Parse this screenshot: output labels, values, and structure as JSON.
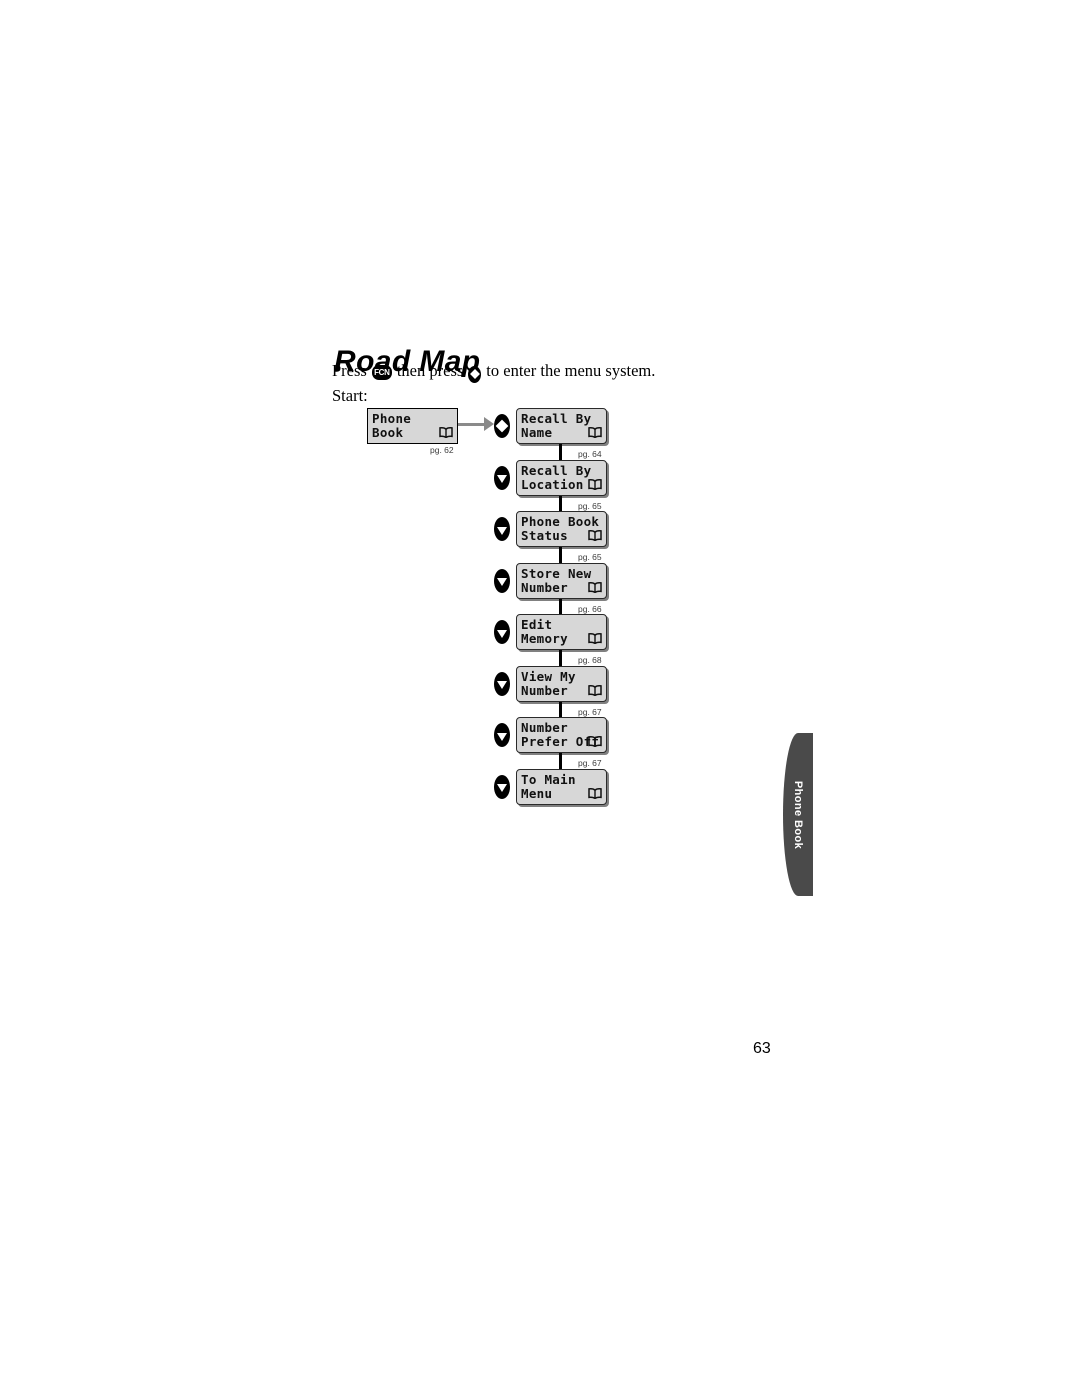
{
  "document": {
    "title": "Road Map",
    "page_number": "63",
    "side_tab_label": "Phone Book"
  },
  "intro": {
    "press_text": "Press",
    "fcn_key_label": "FCN",
    "then_press_text": "then press",
    "nav_key_icon": "nav-diamond-icon",
    "tail_text": "to enter the menu system.",
    "start_label": "Start:"
  },
  "start_node": {
    "line1": "Phone",
    "line2": "Book",
    "icon": "book-icon",
    "page_ref": "pg. 62"
  },
  "arrow": {
    "icon": "right-arrow-icon"
  },
  "menu_items": [
    {
      "line1": "Recall By",
      "line2": "Name",
      "icon": "book-icon",
      "page_ref": "pg. 64",
      "key_icon": "nav-diamond-icon"
    },
    {
      "line1": "Recall By",
      "line2": "Location",
      "icon": "book-icon",
      "page_ref": "pg. 65",
      "key_icon": "nav-down-icon"
    },
    {
      "line1": "Phone Book",
      "line2": "Status",
      "icon": "book-icon",
      "page_ref": "pg. 65",
      "key_icon": "nav-down-icon"
    },
    {
      "line1": "Store New",
      "line2": "Number",
      "icon": "book-icon",
      "page_ref": "pg. 66",
      "key_icon": "nav-down-icon"
    },
    {
      "line1": "Edit",
      "line2": "Memory",
      "icon": "book-icon",
      "page_ref": "pg. 68",
      "key_icon": "nav-down-icon"
    },
    {
      "line1": "View My",
      "line2": "Number",
      "icon": "book-icon",
      "page_ref": "pg. 67",
      "key_icon": "nav-down-icon"
    },
    {
      "line1": "Number",
      "line2": "Prefer Off",
      "icon": "book-icon",
      "page_ref": "pg. 67",
      "key_icon": "nav-down-icon"
    },
    {
      "line1": "To Main",
      "line2": "Menu",
      "icon": "book-icon",
      "page_ref": "",
      "key_icon": "nav-down-icon"
    }
  ],
  "colors": {
    "box_fill": "#d7d7d7",
    "box_border": "#2a2a2a",
    "key_fill": "#000000",
    "arrow": "#8a8a8a",
    "tab_fill": "#4a4a4a",
    "page_ref_text": "#3c3c3c"
  }
}
